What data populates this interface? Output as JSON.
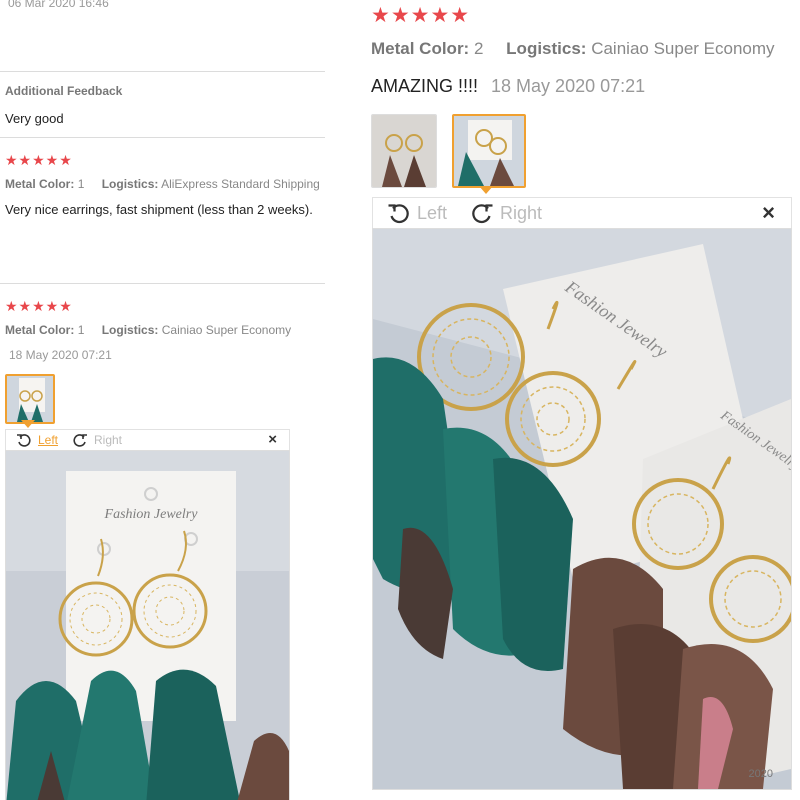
{
  "left": {
    "prev_review": {
      "date": "06 Mar 2020 16:46"
    },
    "additional_feedback": {
      "heading": "Additional Feedback",
      "text": "Very good"
    },
    "review1": {
      "stars": "★★★★★",
      "metal_label": "Metal Color:",
      "metal_value": "1",
      "logistics_label": "Logistics:",
      "logistics_value": "AliExpress Standard Shipping",
      "text": "Very nice earrings, fast shipment (less than 2 weeks)."
    },
    "review2": {
      "stars": "★★★★★",
      "metal_label": "Metal Color:",
      "metal_value": "1",
      "logistics_label": "Logistics:",
      "logistics_value": "Cainiao Super Economy",
      "date": "18 May 2020 07:21",
      "toolbar": {
        "left_label": "Left",
        "right_label": "Right",
        "close": "×"
      },
      "card_text": "Fashion Jewelry"
    }
  },
  "right": {
    "review": {
      "stars": "★★★★★",
      "metal_label": "Metal Color:",
      "metal_value": "2",
      "logistics_label": "Logistics:",
      "logistics_value": "Cainiao Super Economy",
      "text": "AMAZING !!!!",
      "date": "18 May 2020 07:21",
      "toolbar": {
        "left_label": "Left",
        "right_label": "Right",
        "close": "×"
      },
      "card_text": "Fashion Jewelry",
      "card_text_2": "Fashion Jewelry",
      "photo_stamp": "2020"
    }
  },
  "colors": {
    "star": "#e8474b",
    "selected_border": "#f0a030",
    "link": "#f0a030",
    "feather_teal": "#1f6e68",
    "feather_brown": "#6b4a3e"
  }
}
